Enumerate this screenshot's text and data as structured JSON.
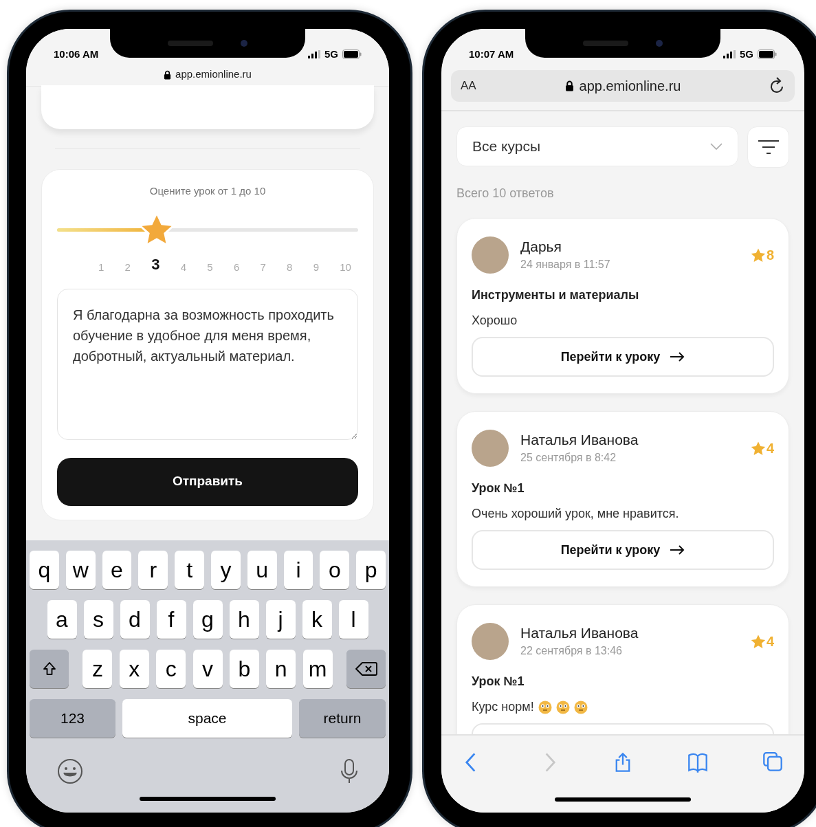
{
  "left_phone": {
    "status_bar": {
      "time": "10:06 AM",
      "network": "5G"
    },
    "address": {
      "url": "app.emionline.ru"
    },
    "rating_card": {
      "prompt": "Оцените урок от 1 до 10",
      "slider": {
        "level": 0.33
      },
      "scale": [
        {
          "label": "1",
          "selected": false
        },
        {
          "label": "2",
          "selected": false
        },
        {
          "label": "3",
          "selected": true
        },
        {
          "label": "4",
          "selected": false
        },
        {
          "label": "5",
          "selected": false
        },
        {
          "label": "6",
          "selected": false
        },
        {
          "label": "7",
          "selected": false
        },
        {
          "label": "8",
          "selected": false
        },
        {
          "label": "9",
          "selected": false
        },
        {
          "label": "10",
          "selected": false
        }
      ],
      "feedback": {
        "value": "Я благодарна за возможность проходить обучение в удобное для меня время, добротный, актуальный материал.\n"
      },
      "submit": "Отправить"
    },
    "keyboard": {
      "rows": [
        [
          {
            "kind": "letter",
            "label": "q"
          },
          {
            "kind": "letter",
            "label": "w"
          },
          {
            "kind": "letter",
            "label": "e"
          },
          {
            "kind": "letter",
            "label": "r"
          },
          {
            "kind": "letter",
            "label": "t"
          },
          {
            "kind": "letter",
            "label": "y"
          },
          {
            "kind": "letter",
            "label": "u"
          },
          {
            "kind": "letter",
            "label": "i"
          },
          {
            "kind": "letter",
            "label": "o"
          },
          {
            "kind": "letter",
            "label": "p"
          }
        ],
        [
          {
            "kind": "letter",
            "label": "a"
          },
          {
            "kind": "letter",
            "label": "s"
          },
          {
            "kind": "letter",
            "label": "d"
          },
          {
            "kind": "letter",
            "label": "f"
          },
          {
            "kind": "letter",
            "label": "g"
          },
          {
            "kind": "letter",
            "label": "h"
          },
          {
            "kind": "letter",
            "label": "j"
          },
          {
            "kind": "letter",
            "label": "k"
          },
          {
            "kind": "letter",
            "label": "l"
          }
        ],
        [
          {
            "kind": "shift"
          },
          {
            "kind": "letter",
            "label": "z"
          },
          {
            "kind": "letter",
            "label": "x"
          },
          {
            "kind": "letter",
            "label": "c"
          },
          {
            "kind": "letter",
            "label": "v"
          },
          {
            "kind": "letter",
            "label": "b"
          },
          {
            "kind": "letter",
            "label": "n"
          },
          {
            "kind": "letter",
            "label": "m"
          },
          {
            "kind": "backspace"
          }
        ]
      ],
      "numbers_key": "123",
      "space_key": "space",
      "return_key": "return"
    }
  },
  "right_phone": {
    "status_bar": {
      "time": "10:07 AM",
      "network": "5G"
    },
    "address": {
      "text_size": "AA",
      "url": "app.emionline.ru"
    },
    "course_select": {
      "value": "Все курсы"
    },
    "total": "Всего 10 ответов",
    "reviews": [
      {
        "name": "Дарья",
        "date": "24 января в 11:57",
        "rating": "8",
        "lesson": "Инструменты и материалы",
        "comment": "Хорошо",
        "button": "Перейти к уроку"
      },
      {
        "name": "Наталья Иванова",
        "date": "25 сентября в 8:42",
        "rating": "4",
        "lesson": "Урок №1",
        "comment": "Очень хороший урок, мне нравится.",
        "button": "Перейти к уроку"
      },
      {
        "name": "Наталья Иванова",
        "date": "22 сентября в 13:46",
        "rating": "4",
        "lesson": "Урок №1",
        "comment": "Курс норм!",
        "trailing_icons": [
          {
            "kind": "face"
          },
          {
            "kind": "face"
          },
          {
            "kind": "face"
          }
        ]
      }
    ],
    "toolbar": [
      {
        "kind": "back",
        "disabled": false
      },
      {
        "kind": "forward",
        "disabled": true
      },
      {
        "kind": "share",
        "disabled": false
      },
      {
        "kind": "bookmarks",
        "disabled": false
      },
      {
        "kind": "tabs",
        "disabled": false
      }
    ]
  }
}
